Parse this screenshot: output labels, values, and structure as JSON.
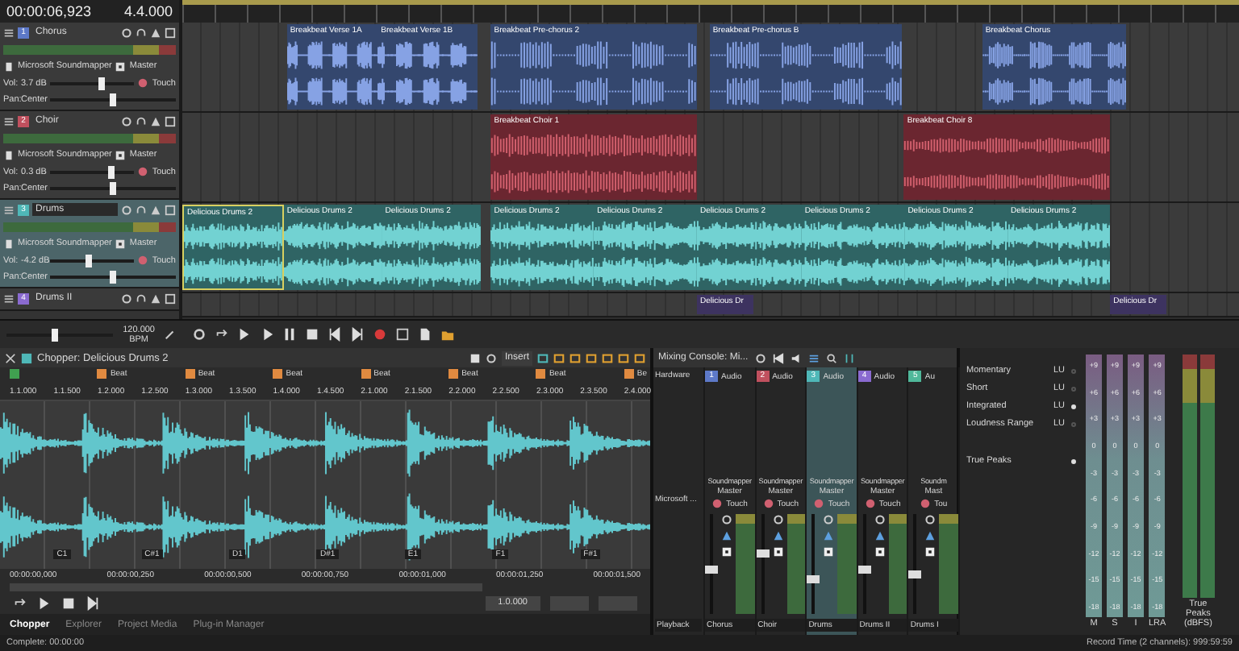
{
  "timeline": {
    "time": "00:00:06,923",
    "beat": "4.4.000"
  },
  "tracks": [
    {
      "number": "1",
      "name": "Chorus",
      "color": "#5d79c8",
      "selected": false,
      "device": "Microsoft Soundmapper",
      "bus": "Master",
      "volume": {
        "label": "Vol:",
        "reading": "3.7 dB",
        "level": 0.62
      },
      "pan": {
        "label": "Pan:",
        "reading": "Center",
        "level": 0.5
      },
      "automation": "Touch",
      "clips": [
        {
          "name": "Breakbeat Verse 1A",
          "selected": false
        },
        {
          "name": "Breakbeat Verse 1B",
          "selected": false
        },
        {
          "name": "Breakbeat Pre-chorus 2",
          "selected": false
        },
        {
          "name": "Breakbeat Pre-chorus B",
          "selected": false
        },
        {
          "name": "Breakbeat Chorus",
          "selected": false
        }
      ]
    },
    {
      "number": "2",
      "name": "Choir",
      "color": "#c0505e",
      "selected": false,
      "device": "Microsoft Soundmapper",
      "bus": "Master",
      "volume": {
        "label": "Vol:",
        "reading": "0.3 dB",
        "level": 0.72
      },
      "pan": {
        "label": "Pan:",
        "reading": "Center",
        "level": 0.5
      },
      "automation": "Touch",
      "clips": [
        {
          "name": "Breakbeat Choir 1",
          "selected": false
        },
        {
          "name": "Breakbeat Choir 8",
          "selected": false
        }
      ]
    },
    {
      "number": "3",
      "name": "Drums",
      "color": "#4fb8b8",
      "selected": true,
      "device": "Microsoft Soundmapper",
      "bus": "Master",
      "volume": {
        "label": "Vol:",
        "reading": "-4.2 dB",
        "level": 0.45
      },
      "pan": {
        "label": "Pan:",
        "reading": "Center",
        "level": 0.5
      },
      "automation": "Touch",
      "clips": [
        {
          "name": "Delicious Drums 2",
          "selected": true
        },
        {
          "name": "Delicious Drums 2",
          "selected": false
        },
        {
          "name": "Delicious Drums 2",
          "selected": false
        },
        {
          "name": "Delicious Drums 2",
          "selected": false
        },
        {
          "name": "Delicious Drums 2",
          "selected": false
        },
        {
          "name": "Delicious Drums 2",
          "selected": false
        },
        {
          "name": "Delicious Drums 2",
          "selected": false
        },
        {
          "name": "Delicious Drums 2",
          "selected": false
        },
        {
          "name": "Delicious Drums 2",
          "selected": false
        }
      ]
    },
    {
      "number": "4",
      "name": "Drums II",
      "color": "#8a6ad0",
      "selected": false,
      "clips": [
        {
          "name": "Delicious Dr",
          "selected": false
        },
        {
          "name": "Delicious Dr",
          "selected": false
        }
      ]
    }
  ],
  "tempo": {
    "value": "120.000",
    "unit": "BPM",
    "level": 0.45
  },
  "chopper": {
    "title": "Chopper: Delicious Drums 2",
    "insert": "Insert",
    "markers": [
      {
        "color": "#40a050"
      },
      {
        "label": "Beat",
        "color": "#e08a40"
      },
      {
        "label": "Beat",
        "color": "#e08a40"
      },
      {
        "label": "Beat",
        "color": "#e08a40"
      },
      {
        "label": "Beat",
        "color": "#e08a40"
      },
      {
        "label": "Beat",
        "color": "#e08a40"
      },
      {
        "label": "Beat",
        "color": "#e08a40"
      },
      {
        "label": "Be",
        "color": "#e08a40"
      }
    ],
    "ruler": [
      "1.1.000",
      "1.1.500",
      "1.2.000",
      "1.2.500",
      "1.3.000",
      "1.3.500",
      "1.4.000",
      "1.4.500",
      "2.1.000",
      "2.1.500",
      "2.2.000",
      "2.2.500",
      "2.3.000",
      "2.3.500",
      "2.4.000"
    ],
    "pads": [
      "C1",
      "C#1",
      "D1",
      "D#1",
      "E1",
      "F1",
      "F#1"
    ],
    "times": [
      "00:00:00,000",
      "00:00:00,250",
      "00:00:00,500",
      "00:00:00,750",
      "00:00:01,000",
      "00:00:01,250",
      "00:00:01,500"
    ],
    "length": "1.0.000"
  },
  "bottom_tabs": [
    {
      "label": "Chopper",
      "selected": true
    },
    {
      "label": "Explorer",
      "selected": false
    },
    {
      "label": "Project Media",
      "selected": false
    },
    {
      "label": "Plug-in Manager",
      "selected": false
    }
  ],
  "mixer": {
    "title": "Mixing Console: Mi...",
    "hardware": {
      "header": "Hardware",
      "device": "Microsoft ...",
      "name": "Playback"
    },
    "strips": [
      {
        "number": "1",
        "color": "#5d79c8",
        "type": "Audio",
        "send": "Soundmapper",
        "bus": "Master",
        "automation": "Touch",
        "name": "Chorus",
        "selected": false,
        "level": 0.45
      },
      {
        "number": "2",
        "color": "#c0505e",
        "type": "Audio",
        "send": "Soundmapper",
        "bus": "Master",
        "automation": "Touch",
        "name": "Choir",
        "selected": false,
        "level": 0.62
      },
      {
        "number": "3",
        "color": "#4fb8b8",
        "type": "Audio",
        "send": "Soundmapper",
        "bus": "Master",
        "automation": "Touch",
        "name": "Drums",
        "selected": true,
        "level": 0.35
      },
      {
        "number": "4",
        "color": "#8a6ad0",
        "type": "Audio",
        "send": "Soundmapper",
        "bus": "Master",
        "automation": "Touch",
        "name": "Drums II",
        "selected": false,
        "level": 0.45
      },
      {
        "number": "5",
        "color": "#4fb89a",
        "type": "Au",
        "send": "Soundm",
        "bus": "Mast",
        "automation": "Tou",
        "name": "Drums I",
        "selected": false,
        "level": 0.4
      }
    ]
  },
  "loudness": {
    "rows": [
      {
        "label": "Momentary",
        "value": "LU",
        "on": false
      },
      {
        "label": "Short",
        "value": "LU",
        "on": false
      },
      {
        "label": "Integrated",
        "value": "LU",
        "on": true
      },
      {
        "label": "Loudness Range",
        "value": "LU",
        "on": false
      }
    ],
    "true_peaks": {
      "label": "True Peaks",
      "on": true
    },
    "meters": [
      {
        "label": "M",
        "scale": [
          "+9",
          "+6",
          "+3",
          "0",
          "-3",
          "-6",
          "-9",
          "-12",
          "-15",
          "-18"
        ]
      },
      {
        "label": "S",
        "scale": [
          "+9",
          "+6",
          "+3",
          "0",
          "-3",
          "-6",
          "-9",
          "-12",
          "-15",
          "-18"
        ]
      },
      {
        "label": "I",
        "scale": [
          "+9",
          "+6",
          "+3",
          "0",
          "-3",
          "-6",
          "-9",
          "-12",
          "-15",
          "-18"
        ]
      },
      {
        "label": "LRA",
        "scale": [
          "+9",
          "+6",
          "+3",
          "0",
          "-3",
          "-6",
          "-9",
          "-12",
          "-15",
          "-18"
        ]
      }
    ],
    "peaks_label": "True Peaks (dBFS)"
  },
  "status": {
    "left": "Complete: 00:00:00",
    "right": "Record Time (2 channels): 999:59:59"
  }
}
